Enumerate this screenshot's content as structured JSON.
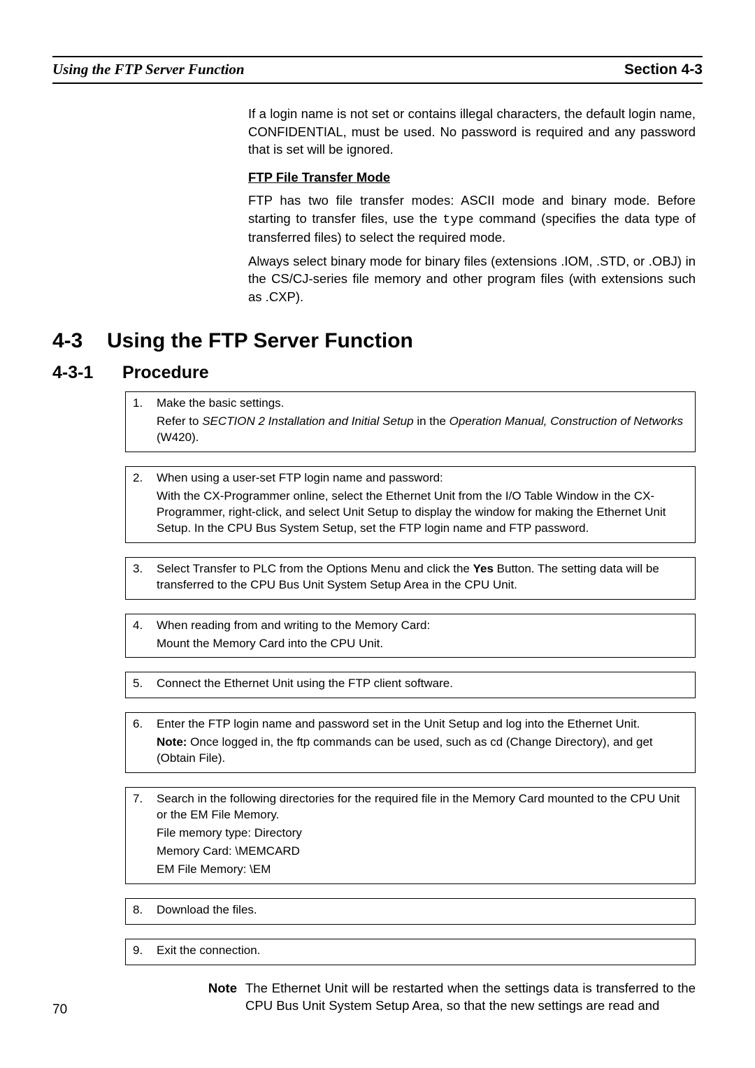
{
  "header": {
    "left": "Using the FTP Server Function",
    "right": "Section 4-3"
  },
  "intro": {
    "p1": "If a login name is not set or contains illegal characters, the default login name, CONFIDENTIAL, must be used. No password is required and any password that is set will be ignored.",
    "ftp_heading": "FTP File Transfer Mode",
    "p2a": "FTP has two file transfer modes: ASCII mode and binary mode. Before starting to transfer files, use the ",
    "p2_code": "type",
    "p2b": " command (specifies the data type of transferred files) to select the required mode.",
    "p3": "Always select binary mode for binary files (extensions .IOM, .STD, or .OBJ) in the CS/CJ-series file memory and other program files (with extensions such as .CXP)."
  },
  "section": {
    "num": "4-3",
    "title": "Using the FTP Server Function"
  },
  "subsection": {
    "num": "4-3-1",
    "title": "Procedure"
  },
  "steps": {
    "s1": {
      "num": "1.",
      "l1": "Make the basic settings.",
      "l2a": "Refer to ",
      "l2_italic": "SECTION 2 Installation and Initial Setup",
      "l2b": " in the ",
      "l2_italic2": "Operation Manual, Construction of Networks",
      "l2c": " (W420)."
    },
    "s2": {
      "num": "2.",
      "l1": "When using a user-set FTP login name and password:",
      "l2": "With the CX-Programmer online, select the Ethernet Unit from the I/O Table Window in the CX-Programmer, right-click, and select Unit Setup  to display the window for making the Ethernet Unit Setup. In the CPU Bus System Setup, set the FTP login name and FTP password."
    },
    "s3": {
      "num": "3.",
      "l1a": "Select Transfer to PLC   from the Options Menu and click the ",
      "l1_bold": "Yes",
      "l1b": " Button. The setting data will be transferred to the CPU Bus Unit System Setup Area in the CPU Unit."
    },
    "s4": {
      "num": "4.",
      "l1": "When reading from and writing to the Memory Card:",
      "l2": "Mount the Memory Card into the CPU Unit."
    },
    "s5": {
      "num": "5.",
      "l1": "Connect the Ethernet Unit using the FTP client software."
    },
    "s6": {
      "num": "6.",
      "l1": "Enter the FTP login name and password set in the Unit Setup and log into the Ethernet Unit.",
      "l2_bold": "Note:",
      "l2": " Once logged in, the ftp commands can be used, such as cd (Change Directory), and get (Obtain File)."
    },
    "s7": {
      "num": "7.",
      "l1": "Search in the following directories for the required file in the Memory Card mounted to the CPU Unit or the EM File Memory.",
      "l2": "File memory type: Directory",
      "l3": "Memory Card: \\MEMCARD",
      "l4": "EM File Memory:  \\EM"
    },
    "s8": {
      "num": "8.",
      "l1": "Download the files."
    },
    "s9": {
      "num": "9.",
      "l1": "Exit the connection."
    }
  },
  "note": {
    "label": "Note",
    "text": "The Ethernet Unit will be restarted when the settings data is transferred to the CPU Bus Unit System Setup Area, so that the new settings are read and"
  },
  "page_number": "70"
}
